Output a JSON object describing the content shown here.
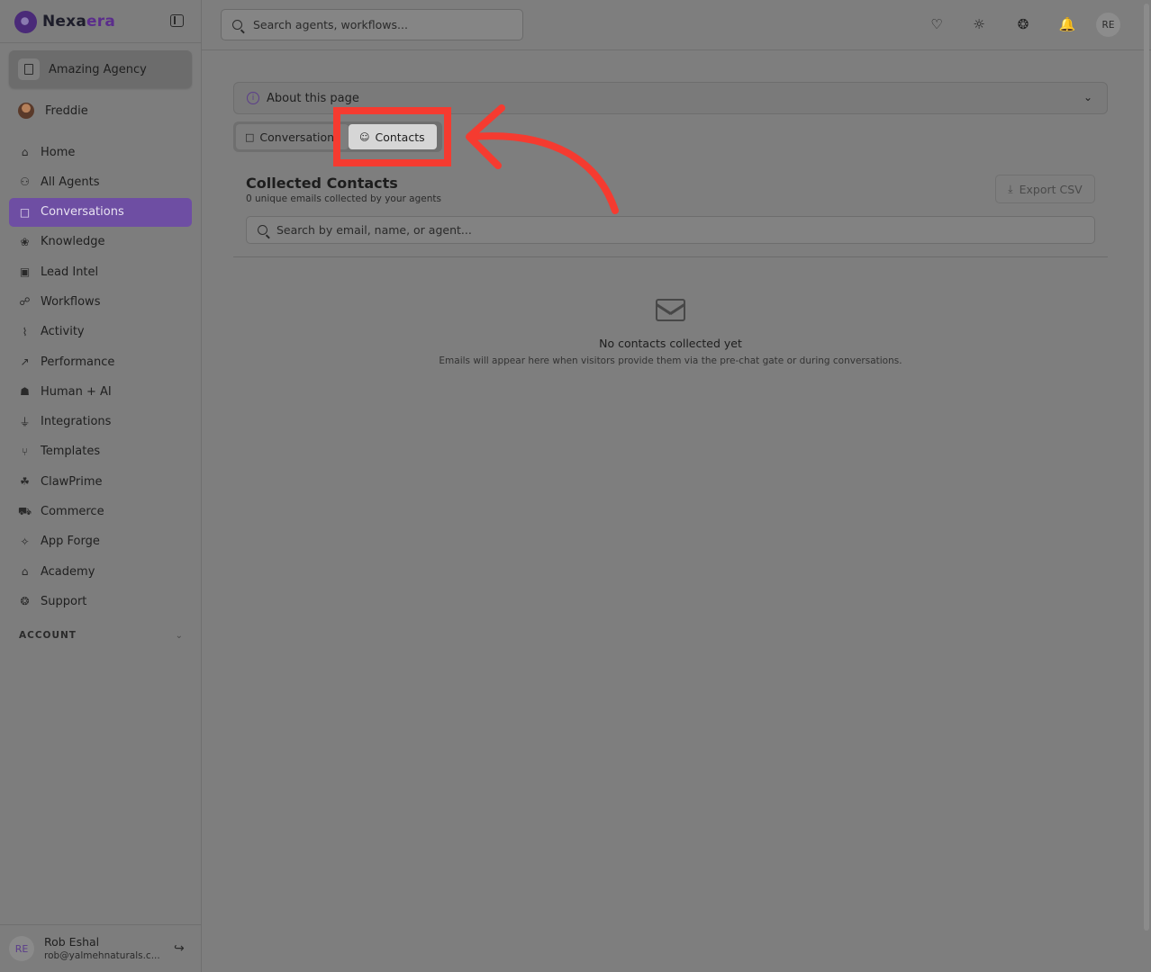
{
  "brand": {
    "name_part1": "Nexa",
    "name_part2": "era"
  },
  "agency": {
    "label": "Amazing Agency"
  },
  "user": {
    "name": "Freddie"
  },
  "nav": {
    "items": [
      {
        "label": "Home",
        "icon": "home-icon"
      },
      {
        "label": "All Agents",
        "icon": "robot-icon"
      },
      {
        "label": "Conversations",
        "icon": "chat-icon"
      },
      {
        "label": "Knowledge",
        "icon": "brain-icon"
      },
      {
        "label": "Lead Intel",
        "icon": "id-card-icon"
      },
      {
        "label": "Workflows",
        "icon": "workflow-icon"
      },
      {
        "label": "Activity",
        "icon": "activity-icon"
      },
      {
        "label": "Performance",
        "icon": "trending-up-icon"
      },
      {
        "label": "Human + AI",
        "icon": "network-icon"
      },
      {
        "label": "Integrations",
        "icon": "plug-icon"
      },
      {
        "label": "Templates",
        "icon": "share-icon"
      },
      {
        "label": "ClawPrime",
        "icon": "cluster-icon"
      },
      {
        "label": "Commerce",
        "icon": "cart-icon"
      },
      {
        "label": "App Forge",
        "icon": "sparkles-icon"
      },
      {
        "label": "Academy",
        "icon": "graduation-cap-icon"
      },
      {
        "label": "Support",
        "icon": "lifebuoy-icon"
      }
    ],
    "active_index": 2,
    "account_label": "ACCOUNT"
  },
  "profile": {
    "initials": "RE",
    "name": "Rob Eshal",
    "email": "rob@yalmehnaturals.c..."
  },
  "header": {
    "search_placeholder": "Search agents, workflows...",
    "avatar_initials": "RE"
  },
  "about": {
    "label": "About this page"
  },
  "tabs": [
    {
      "label": "Conversations",
      "visible_text": "Conversation"
    },
    {
      "label": "Contacts"
    }
  ],
  "contacts": {
    "title": "Collected Contacts",
    "subtitle": "0 unique emails collected by your agents",
    "export_label": "Export CSV",
    "search_placeholder": "Search by email, name, or agent...",
    "empty_title": "No contacts collected yet",
    "empty_desc": "Emails will appear here when visitors provide them via the pre-chat gate or during conversations."
  },
  "colors": {
    "overlay": "#7e7e7e",
    "accent": "#6e4ea3",
    "annotation": "#f53b30",
    "active_tab": "#d6d6d6"
  }
}
